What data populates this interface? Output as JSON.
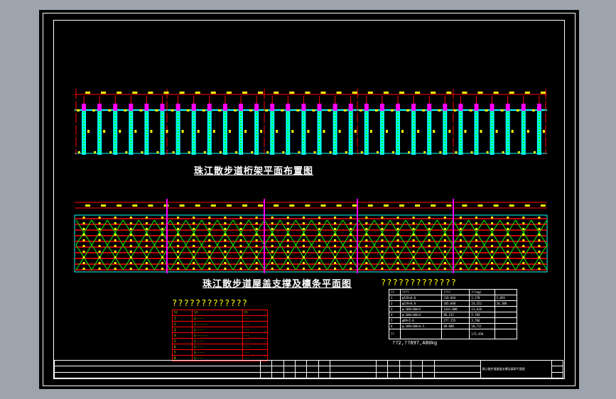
{
  "drawing": {
    "plan_title": "珠江散步道桁架平面布置图",
    "roof_title": "珠江散步道屋盖支撑及檩条平面图",
    "colors": {
      "background": "#000000",
      "axis": "#ff0000",
      "chord": "#00ffff",
      "web": "#00ff00",
      "node": "#ff00ff",
      "label": "#ffff00"
    },
    "truss_count": 30
  },
  "material_table": {
    "title": "?????????????",
    "headers": [
      "??",
      "????",
      "????",
      "??(kg)"
    ],
    "rows": [
      [
        "1",
        "φ159×6.0",
        "219.844",
        "5,270",
        "5,859"
      ],
      [
        "2",
        "φ219×8.0",
        "345.048",
        "24,152",
        "24,188"
      ],
      [
        "3",
        "φ-100×100×5",
        "1433.000",
        "13,618",
        ""
      ],
      [
        "4",
        "φ-100×100×3",
        "86.152",
        "5,784",
        ""
      ],
      [
        "5",
        "φ89×5.0",
        "277.255",
        "3,766",
        ""
      ],
      [
        "6",
        "φ-100×100×4.5",
        "88.800",
        "10,711",
        ""
      ]
    ],
    "total_label": "??",
    "total_value": "172,456",
    "note": "??2,??897,480kg"
  },
  "member_table": {
    "title": "?????????????",
    "headers": [
      "??",
      "??",
      "??"
    ],
    "rows": [
      [
        "1",
        "L-----",
        "---"
      ],
      [
        "2",
        "L-------",
        "---"
      ],
      [
        "3",
        "L-----",
        "---"
      ],
      [
        "4",
        "L-------",
        "---"
      ],
      [
        "5",
        "L-----",
        "---"
      ],
      [
        "6",
        "L-----",
        "---"
      ],
      [
        "7",
        "L-----",
        "---"
      ],
      [
        "8",
        "L----",
        "---"
      ]
    ]
  },
  "title_block": {
    "drawing_name": "珠江散步道屋盖支撑及檩条平面图"
  }
}
